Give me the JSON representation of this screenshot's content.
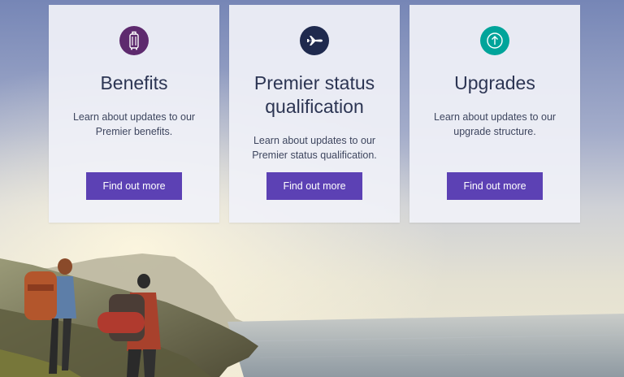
{
  "cards": [
    {
      "icon": "luggage-icon",
      "icon_color": "#5e2a6e",
      "title": "Benefits",
      "description": "Learn about updates to our Premier benefits.",
      "button_label": "Find out more"
    },
    {
      "icon": "airplane-icon",
      "icon_color": "#1f2a4e",
      "title": "Premier status qualification",
      "description": "Learn about updates to our Premier status qualification.",
      "button_label": "Find out more"
    },
    {
      "icon": "arrow-up-circle-icon",
      "icon_color": "#00a49a",
      "title": "Upgrades",
      "description": "Learn about updates to our upgrade structure.",
      "button_label": "Find out more"
    }
  ],
  "colors": {
    "button_bg": "#5c41b4",
    "title_text": "#2c3553",
    "body_text": "#3e465f"
  }
}
